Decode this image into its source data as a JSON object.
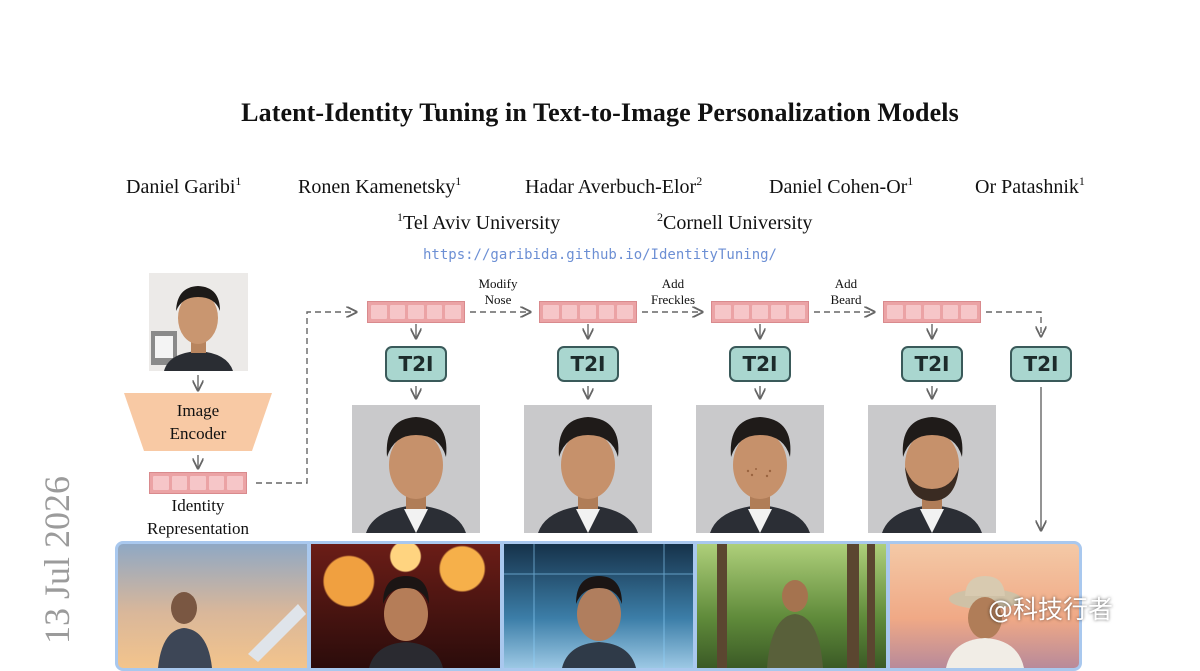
{
  "title": "Latent-Identity Tuning in Text-to-Image Personalization Models",
  "authors": [
    {
      "name": "Daniel Garibi",
      "sup": "1"
    },
    {
      "name": "Ronen Kamenetsky",
      "sup": "1"
    },
    {
      "name": "Hadar Averbuch-Elor",
      "sup": "2"
    },
    {
      "name": "Daniel Cohen-Or",
      "sup": "1"
    },
    {
      "name": "Or Patashnik",
      "sup": "1"
    }
  ],
  "affiliations": [
    {
      "sup": "1",
      "name": "Tel Aviv University"
    },
    {
      "sup": "2",
      "name": "Cornell University"
    }
  ],
  "url": "https://garibida.github.io/IdentityTuning/",
  "arxiv_date": "13 Jul 2026",
  "figure": {
    "encoder_label_line1": "Image",
    "encoder_label_line2": "Encoder",
    "identity_label_line1": "Identity",
    "identity_label_line2": "Representation",
    "t2i_label": "T2I",
    "edits": [
      {
        "line1": "Modify",
        "line2": "Nose"
      },
      {
        "line1": "Add",
        "line2": "Freckles"
      },
      {
        "line1": "Add",
        "line2": "Beard"
      }
    ],
    "colors": {
      "embedding": "#eba3a5",
      "t2i_box": "#a9d6cf",
      "encoder": "#f8c9a4",
      "strip_border": "#a9c8ee"
    }
  },
  "watermark": "@科技行者"
}
